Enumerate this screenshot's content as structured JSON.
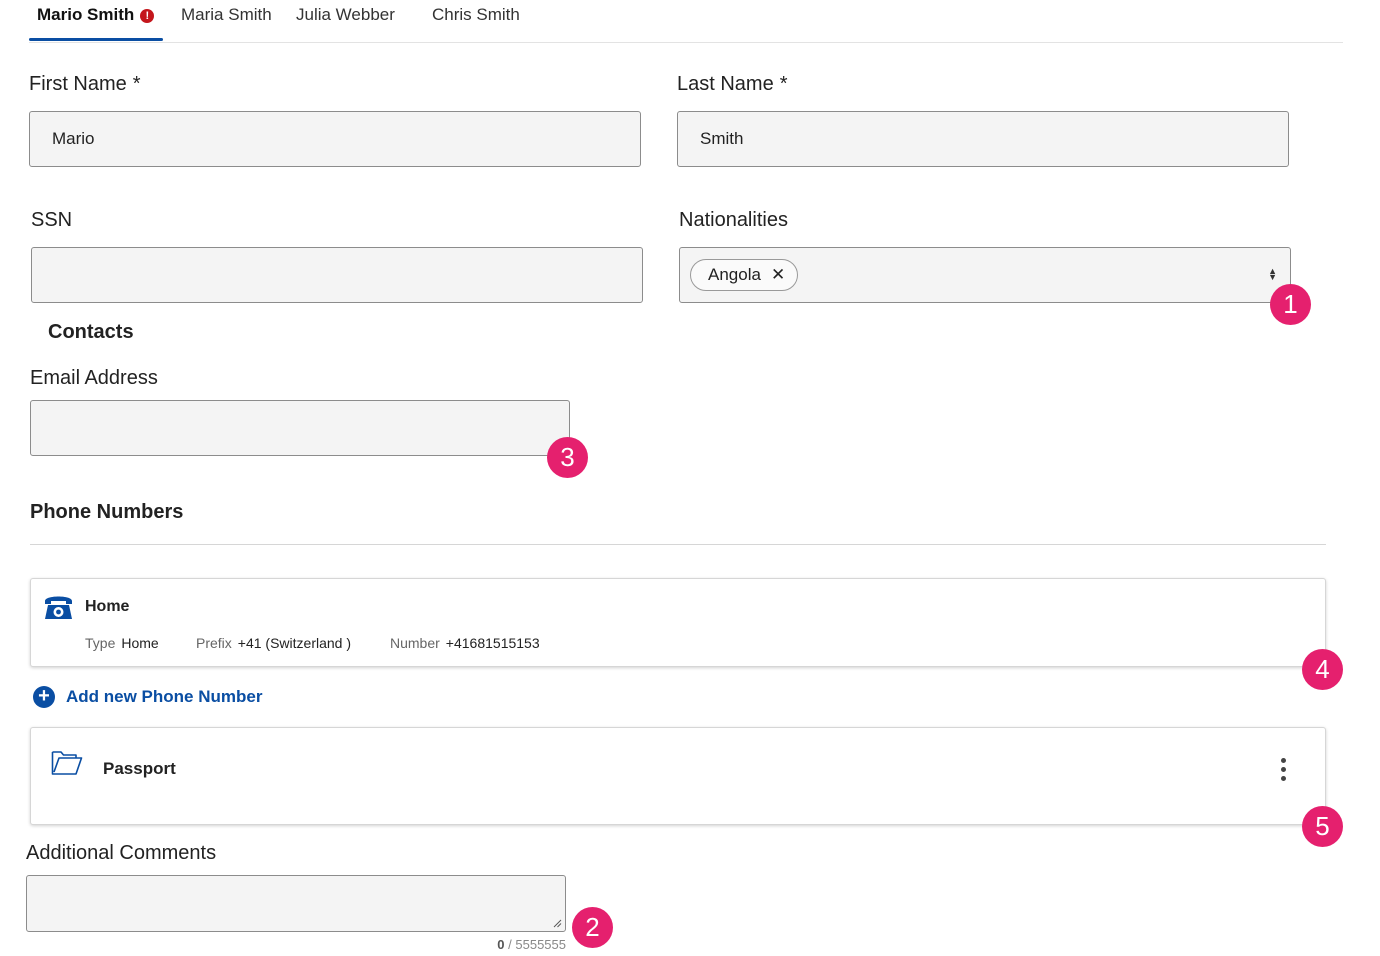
{
  "tabs": [
    {
      "label": "Mario Smith",
      "active": true,
      "error": true
    },
    {
      "label": "Maria Smith"
    },
    {
      "label": "Julia Webber"
    },
    {
      "label": "Chris Smith"
    }
  ],
  "required_mark": "*",
  "form": {
    "first_name": {
      "label": "First Name",
      "value": "Mario"
    },
    "last_name": {
      "label": "Last Name",
      "value": "Smith"
    },
    "ssn": {
      "label": "SSN",
      "value": ""
    },
    "nationalities": {
      "label": "Nationalities",
      "selected": [
        "Angola"
      ]
    }
  },
  "contacts": {
    "title": "Contacts",
    "email": {
      "label": "Email Address",
      "value": ""
    }
  },
  "phone_numbers": {
    "title": "Phone Numbers",
    "items": [
      {
        "title": "Home",
        "type_label": "Type",
        "type": "Home",
        "prefix_label": "Prefix",
        "prefix": "+41 (Switzerland )",
        "number_label": "Number",
        "number": "+41681515153"
      }
    ],
    "add_label": "Add new Phone Number"
  },
  "documents": [
    {
      "title": "Passport"
    }
  ],
  "comments": {
    "label": "Additional Comments",
    "value": "",
    "count": "0",
    "max": "/ 5555555"
  },
  "badges": [
    "1",
    "2",
    "3",
    "4",
    "5"
  ],
  "colors": {
    "accent": "#0a4ea3",
    "badge": "#e5206e",
    "error": "#c4161c"
  }
}
